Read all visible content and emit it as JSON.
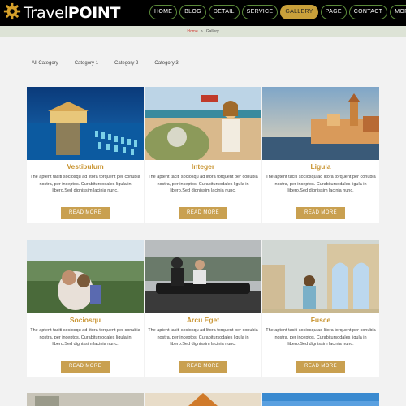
{
  "header": {
    "logo_text_light": "Travel",
    "logo_text_bold": "POINT",
    "logo_icon": "gear-icon",
    "nav": [
      {
        "label": "HOME"
      },
      {
        "label": "BLOG"
      },
      {
        "label": "DETAIL"
      },
      {
        "label": "SERVICE"
      },
      {
        "label": "GALLERY",
        "active": true
      },
      {
        "label": "PAGE"
      },
      {
        "label": "CONTACT"
      },
      {
        "label": "MORE▸"
      }
    ]
  },
  "breadcrumb": {
    "home": "Home",
    "separator_icon": "chevron-right-icon",
    "current": "Gallery"
  },
  "tabs": [
    {
      "label": "All Category",
      "active": true
    },
    {
      "label": "Category 1"
    },
    {
      "label": "Category 2"
    },
    {
      "label": "Category 3"
    }
  ],
  "cards": [
    {
      "title": "Vestibulum",
      "desc": "The aptent taciti sociosqu ad litora torquent per conubia nostra, per inceptos. Curabitursodales ligula in libero.Sed dignissim lacinia nunc.",
      "button": "READ MORE"
    },
    {
      "title": "Integer",
      "desc": "The aptent taciti sociosqu ad litora torquent per conubia nostra, per inceptos. Curabitursodales ligula in libero.Sed dignissim lacinia nunc.",
      "button": "READ MORE"
    },
    {
      "title": "Ligula",
      "desc": "The aptent taciti sociosqu ad litora torquent per conubia nostra, per inceptos. Curabitursodales ligula in libero.Sed dignissim lacinia nunc.",
      "button": "READ MORE"
    },
    {
      "title": "Sociosqu",
      "desc": "The aptent taciti sociosqu ad litora torquent per conubia nostra, per inceptos. Curabitursodales ligula in libero.Sed dignissim lacinia nunc.",
      "button": "READ MORE"
    },
    {
      "title": "Arcu Eget",
      "desc": "The aptent taciti sociosqu ad litora torquent per conubia nostra, per inceptos. Curabitursodales ligula in libero.Sed dignissim lacinia nunc.",
      "button": "READ MORE"
    },
    {
      "title": "Fusce",
      "desc": "The aptent taciti sociosqu ad litora torquent per conubia nostra, per inceptos. Curabitursodales ligula in libero.Sed dignissim lacinia nunc.",
      "button": "READ MORE"
    }
  ],
  "colors": {
    "accent_gold": "#c9a050",
    "title_gold": "#c99533",
    "tab_underline": "#c23a3a",
    "breadcrumb_home": "#d2413a"
  }
}
